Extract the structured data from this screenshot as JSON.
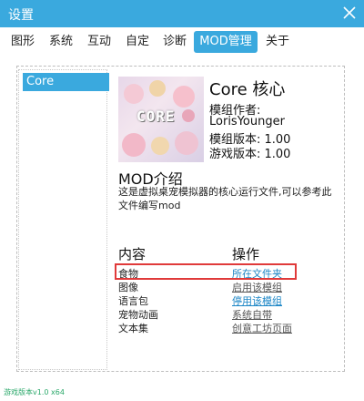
{
  "window": {
    "title": "设置"
  },
  "tabs": [
    {
      "label": "图形"
    },
    {
      "label": "系统"
    },
    {
      "label": "互动"
    },
    {
      "label": "自定"
    },
    {
      "label": "诊断"
    },
    {
      "label": "MOD管理",
      "active": true
    },
    {
      "label": "关于"
    }
  ],
  "mod_list": {
    "items": [
      {
        "label": "Core",
        "selected": true
      }
    ]
  },
  "mod": {
    "title": "Core 核心",
    "thumbnail_text": "CORE",
    "author_label": "模组作者:",
    "author": "LorisYounger",
    "mod_version": "模组版本: 1.00",
    "game_version": "游戏版本: 1.00"
  },
  "intro": {
    "heading": "MOD介绍",
    "text": "这是虚拟桌宠模拟器的核心运行文件,可以参考此文件编写mod"
  },
  "contents": {
    "heading": "内容",
    "items": [
      "食物",
      "图像",
      "语言包",
      "宠物动画",
      "文本集"
    ]
  },
  "operations": {
    "heading": "操作",
    "items": [
      "所在文件夹",
      "启用该模组",
      "停用该模组",
      "系统自带",
      "创意工坊页面"
    ]
  },
  "footer": {
    "version": "游戏版本v1.0 x64"
  },
  "colors": {
    "accent": "#3aa9de",
    "highlight": "#e03a3a",
    "link": "#1c86c6",
    "footer": "#2aa86a"
  }
}
